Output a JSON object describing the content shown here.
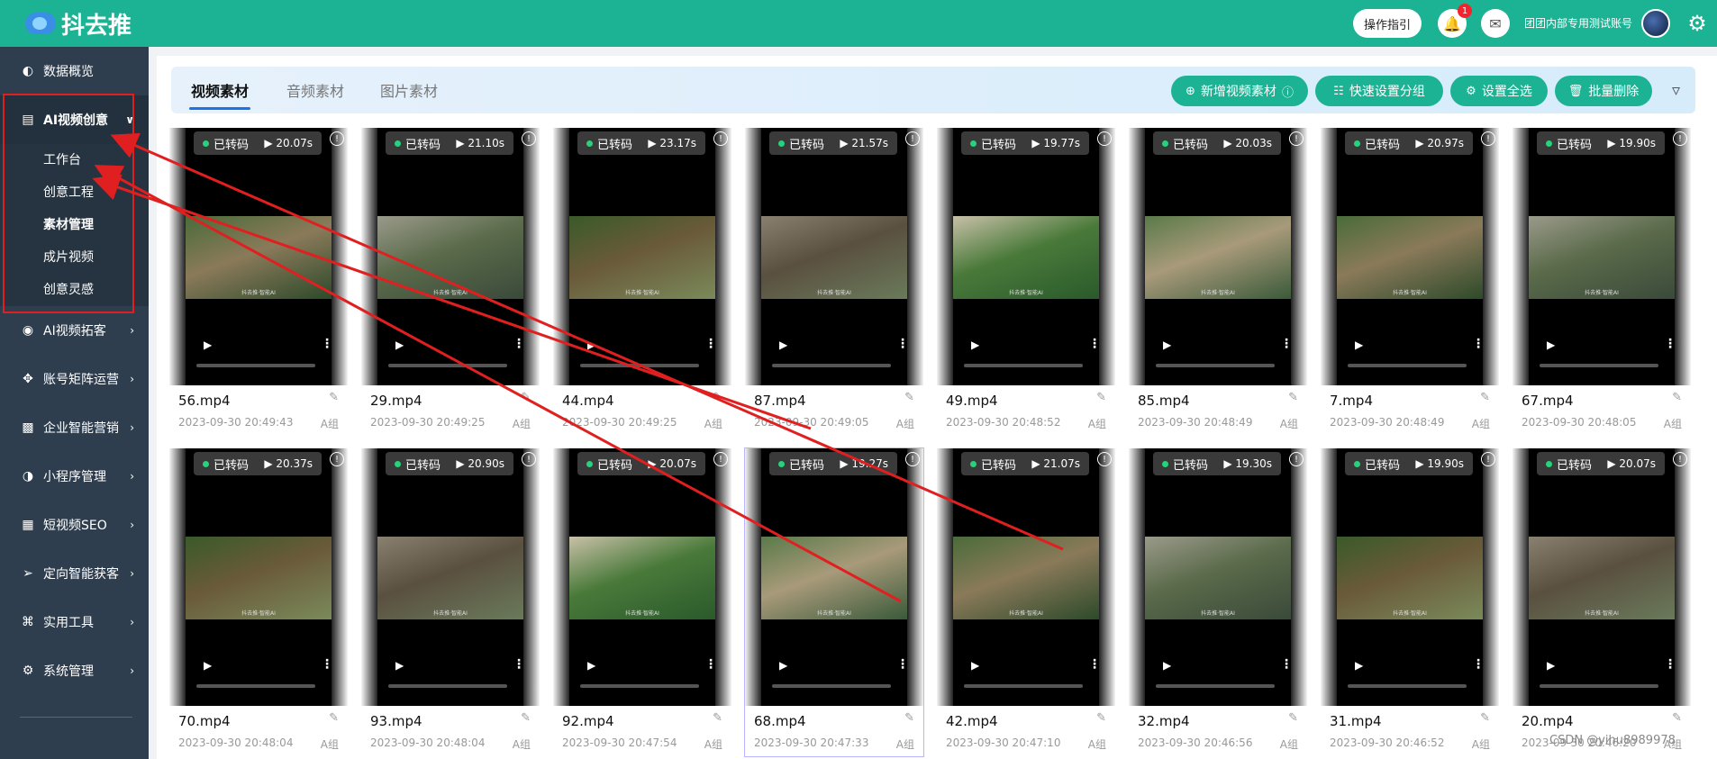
{
  "app": {
    "logo_text": "抖去推"
  },
  "header": {
    "guide_label": "操作指引",
    "notification_count": "1",
    "account_name": "团团内部专用测试账号"
  },
  "sidebar": {
    "items": [
      {
        "label": "数据概览",
        "icon": "dashboard-icon"
      },
      {
        "label": "AI视频创意",
        "icon": "video-icon",
        "expanded": true
      },
      {
        "label": "AI视频拓客",
        "icon": "ai-icon"
      },
      {
        "label": "账号矩阵运营",
        "icon": "matrix-icon"
      },
      {
        "label": "企业智能营销",
        "icon": "chart-icon"
      },
      {
        "label": "小程序管理",
        "icon": "miniapp-icon"
      },
      {
        "label": "短视频SEO",
        "icon": "seo-icon"
      },
      {
        "label": "定向智能获客",
        "icon": "target-icon"
      },
      {
        "label": "实用工具",
        "icon": "tools-icon"
      },
      {
        "label": "系统管理",
        "icon": "settings-icon"
      }
    ],
    "subitems": [
      "工作台",
      "创意工程",
      "素材管理",
      "成片视频",
      "创意灵感"
    ]
  },
  "tabs": [
    "视频素材",
    "音频素材",
    "图片素材"
  ],
  "actions": {
    "add_video": "新增视频素材",
    "quick_group": "快速设置分组",
    "select_all": "设置全选",
    "batch_delete": "批量删除"
  },
  "status_label": "已转码",
  "watermark_text": "抖去推·智能AI",
  "videos": [
    {
      "name": "56.mp4",
      "duration": "20.07s",
      "date": "2023-09-30 20:49:43",
      "group": "A组"
    },
    {
      "name": "29.mp4",
      "duration": "21.10s",
      "date": "2023-09-30 20:49:25",
      "group": "A组"
    },
    {
      "name": "44.mp4",
      "duration": "23.17s",
      "date": "2023-09-30 20:49:25",
      "group": "A组"
    },
    {
      "name": "87.mp4",
      "duration": "21.57s",
      "date": "2023-09-30 20:49:05",
      "group": "A组"
    },
    {
      "name": "49.mp4",
      "duration": "19.77s",
      "date": "2023-09-30 20:48:52",
      "group": "A组"
    },
    {
      "name": "85.mp4",
      "duration": "20.03s",
      "date": "2023-09-30 20:48:49",
      "group": "A组"
    },
    {
      "name": "7.mp4",
      "duration": "20.97s",
      "date": "2023-09-30 20:48:49",
      "group": "A组"
    },
    {
      "name": "67.mp4",
      "duration": "19.90s",
      "date": "2023-09-30 20:48:05",
      "group": "A组"
    },
    {
      "name": "70.mp4",
      "duration": "20.37s",
      "date": "2023-09-30 20:48:04",
      "group": "A组"
    },
    {
      "name": "93.mp4",
      "duration": "20.90s",
      "date": "2023-09-30 20:48:04",
      "group": "A组"
    },
    {
      "name": "92.mp4",
      "duration": "20.07s",
      "date": "2023-09-30 20:47:54",
      "group": "A组"
    },
    {
      "name": "68.mp4",
      "duration": "19.27s",
      "date": "2023-09-30 20:47:33",
      "group": "A组"
    },
    {
      "name": "42.mp4",
      "duration": "21.07s",
      "date": "2023-09-30 20:47:10",
      "group": "A组"
    },
    {
      "name": "32.mp4",
      "duration": "19.30s",
      "date": "2023-09-30 20:46:56",
      "group": "A组"
    },
    {
      "name": "31.mp4",
      "duration": "19.90s",
      "date": "2023-09-30 20:46:52",
      "group": "A组"
    },
    {
      "name": "20.mp4",
      "duration": "20.07s",
      "date": "2023-09-30 20:46:20",
      "group": "A组"
    }
  ],
  "footer_watermark": "CSDN @yihu8989978",
  "colors": {
    "brand": "#1bb394",
    "sidebar": "#2f3e4e",
    "annotation": "#e02020"
  }
}
